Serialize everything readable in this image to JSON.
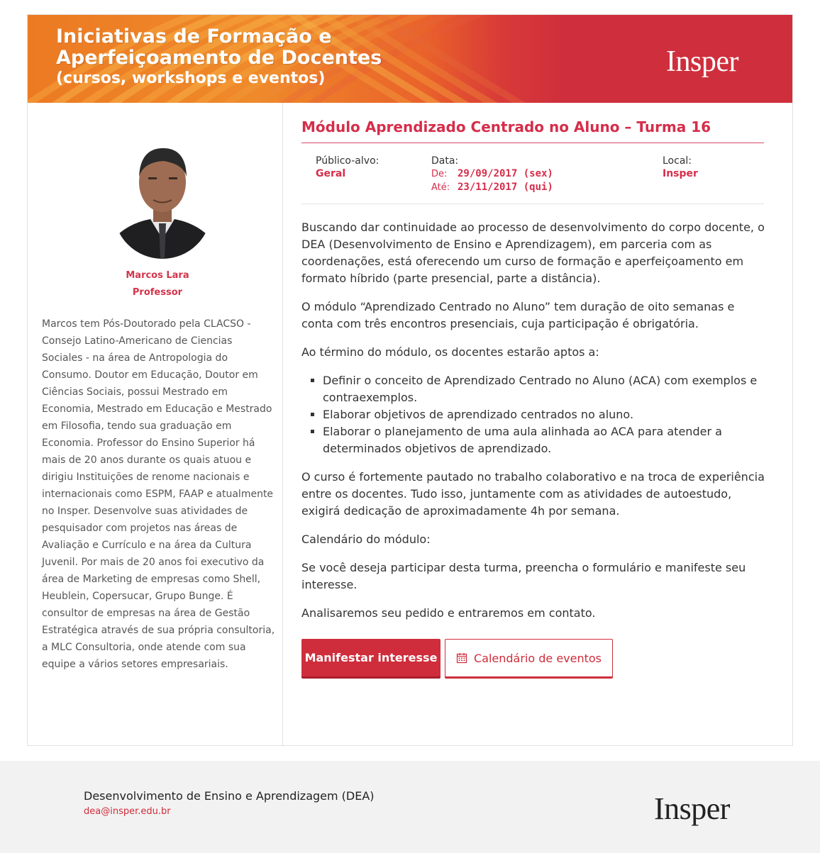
{
  "banner": {
    "title_line1": "Iniciativas de Formação e",
    "title_line2": "Aperfeiçoamento de Docentes",
    "title_line3": "(cursos, workshops e eventos)",
    "logo": "Insper"
  },
  "professor": {
    "name": "Marcos Lara",
    "role": "Professor",
    "bio": "Marcos tem Pós-Doutorado pela CLACSO - Consejo Latino-Americano de Ciencias Sociales - na área de Antropologia do Consumo. Doutor em Educação, Doutor em Ciências Sociais, possui Mestrado em Economia, Mestrado em Educação e Mestrado em Filosofia, tendo sua graduação em Economia. Professor do Ensino Superior há mais de 20 anos durante os quais atuou e dirigiu Instituições de renome nacionais e internacionais como ESPM, FAAP e atualmente no Insper. Desenvolve suas atividades de pesquisador com projetos nas áreas de Avaliação e Currículo e na área da Cultura Juvenil. Por mais de 20 anos foi executivo da área de Marketing de empresas como Shell, Heublein, Copersucar, Grupo Bunge. É consultor de empresas na área de Gestão Estratégica através de sua própria consultoria, a MLC Consultoria, onde atende com sua equipe a vários setores empresariais."
  },
  "module": {
    "title": "Módulo Aprendizado Centrado no Aluno – Turma 16",
    "audience_label": "Público-alvo:",
    "audience_value": "Geral",
    "date_label": "Data:",
    "from_label": "De:",
    "from_value": "29/09/2017 (sex)",
    "to_label": "Até:",
    "to_value": "23/11/2017 (qui)",
    "place_label": "Local:",
    "place_value": "Insper"
  },
  "content": {
    "p1": "Buscando dar continuidade ao processo de desenvolvimento do corpo docente, o DEA (Desenvolvimento de Ensino e Aprendizagem), em parceria com as coordenações, está oferecendo um curso de formação e aperfeiçoamento em formato híbrido (parte presencial, parte a distância).",
    "p2": "O módulo “Aprendizado Centrado no Aluno” tem duração de oito semanas e conta com três encontros presenciais, cuja participação é obrigatória.",
    "p3": "Ao término do módulo, os docentes estarão aptos a:",
    "bullets": [
      "Definir o conceito de Aprendizado Centrado no Aluno (ACA) com exemplos e contraexemplos.",
      "Elaborar objetivos de aprendizado centrados no aluno.",
      "Elaborar o planejamento de uma aula alinhada ao ACA para atender a determinados objetivos de aprendizado."
    ],
    "p4": "O curso é fortemente pautado no trabalho colaborativo e na troca de experiência entre os docentes. Tudo isso, juntamente com as atividades de autoestudo, exigirá dedicação de aproximadamente 4h por semana.",
    "p5": "Calendário do módulo:",
    "p6": "Se você deseja participar desta turma, preencha o formulário e manifeste seu interesse.",
    "p7": "Analisaremos seu pedido e entraremos em contato."
  },
  "buttons": {
    "primary": "Manifestar interesse",
    "secondary": "Calendário de eventos",
    "secondary_icon": "calendar-icon"
  },
  "footer": {
    "title": "Desenvolvimento de Ensino e Aprendizagem (DEA)",
    "email": "dea@insper.edu.br",
    "logo": "Insper"
  },
  "colors": {
    "accent": "#cf2d3b",
    "heading": "#d62d4a",
    "banner_orange": "#ec7a23"
  }
}
